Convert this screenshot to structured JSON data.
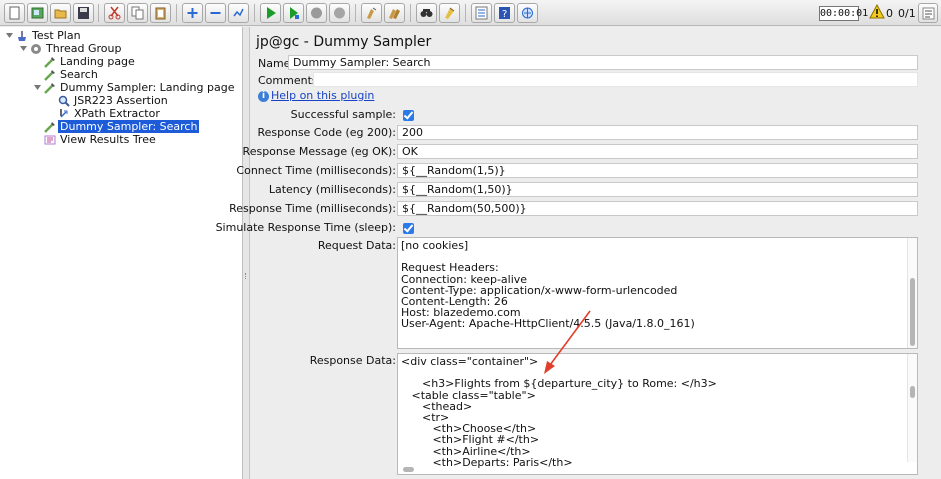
{
  "toolbar": {
    "buttons": [
      "new-icon",
      "templates-icon",
      "open-icon",
      "save-icon",
      "cut-icon",
      "copy-icon",
      "paste-icon",
      "expand-icon",
      "collapse-icon",
      "toggle-icon",
      "start-icon",
      "start-no-pause-icon",
      "stop-icon",
      "shutdown-icon",
      "clear-icon",
      "clear-all-icon",
      "search-icon",
      "reset-search-icon",
      "function-helper-icon",
      "help-icon",
      "remote-icon"
    ],
    "timer": "00:00:01",
    "warning_count": "0",
    "thread_ratio": "0/1"
  },
  "tree": {
    "items": [
      {
        "label": "Test Plan",
        "icon": "test-plan-icon"
      },
      {
        "label": "Thread Group",
        "icon": "gear-icon"
      },
      {
        "label": "Landing page",
        "icon": "sampler-pipette-icon"
      },
      {
        "label": "Search",
        "icon": "sampler-pipette-icon"
      },
      {
        "label": "Dummy Sampler: Landing page",
        "icon": "sampler-pipette-icon"
      },
      {
        "label": "JSR223 Assertion",
        "icon": "magnifier-icon"
      },
      {
        "label": "XPath Extractor",
        "icon": "extractor-arrow-icon"
      },
      {
        "label": "Dummy Sampler: Search",
        "icon": "sampler-pipette-icon"
      },
      {
        "label": "View Results Tree",
        "icon": "results-tree-icon"
      }
    ]
  },
  "panel": {
    "title": "jp@gc - Dummy Sampler",
    "name_label": "Name:",
    "name_value": "Dummy Sampler: Search",
    "comments_label": "Comments:",
    "help_link": "Help on this plugin",
    "successful_label": "Successful sample:",
    "response_code_label": "Response Code (eg 200):",
    "response_code_value": "200",
    "response_message_label": "Response Message (eg OK):",
    "response_message_value": "OK",
    "connect_time_label": "Connect Time (milliseconds):",
    "connect_time_value": "${__Random(1,5)}",
    "latency_label": "Latency (milliseconds):",
    "latency_value": "${__Random(1,50)}",
    "response_time_label": "Response Time (milliseconds):",
    "response_time_value": "${__Random(50,500)}",
    "simulate_label": "Simulate Response Time (sleep):",
    "request_data_label": "Request Data:",
    "request_lines": [
      "[no cookies]",
      "",
      "Request Headers:",
      "Connection: keep-alive",
      "Content-Type: application/x-www-form-urlencoded",
      "Content-Length: 26",
      "Host: blazedemo.com",
      "User-Agent: Apache-HttpClient/4.5.5 (Java/1.8.0_161)"
    ],
    "response_data_label": "Response Data:",
    "response_lines": [
      "<div class=\"container\">",
      "",
      "      <h3>Flights from ${departure_city} to Rome: </h3>",
      "   <table class=\"table\">",
      "      <thead>",
      "      <tr>",
      "         <th>Choose</th>",
      "         <th>Flight #</th>",
      "         <th>Airline</th>",
      "         <th>Departs: Paris</th>"
    ]
  }
}
